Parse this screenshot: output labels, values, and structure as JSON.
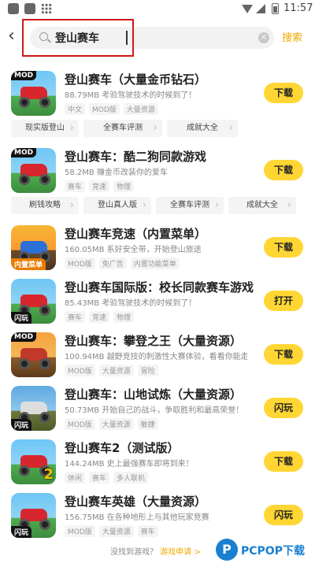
{
  "status_bar": {
    "time": "11:57"
  },
  "header": {
    "search_value": "登山赛车",
    "search_button": "搜索"
  },
  "apps": [
    {
      "title": "登山赛车（大量金币钻石）",
      "desc": "88.79MB 考验驾驶技术的时候到了！",
      "tags": [
        "中文",
        "MOD版",
        "大量资源"
      ],
      "button": "下载",
      "badge_tl": "MOD",
      "badge_bl": "",
      "badge_br": ""
    },
    {
      "title": "登山赛车：酷二狗同款游戏",
      "desc": "58.2MB 赚金币改装你的爱车",
      "tags": [
        "赛车",
        "竞速",
        "物理"
      ],
      "button": "下载",
      "badge_tl": "MOD",
      "badge_bl": "",
      "badge_br": ""
    },
    {
      "title": "登山赛车竞速（内置菜单）",
      "desc": "160.05MB 系好安全带，开始登山旅途",
      "tags": [
        "MOD版",
        "免广告",
        "内置功能菜单"
      ],
      "button": "下载",
      "badge_tl": "",
      "badge_bl": "内置菜单",
      "badge_br": ""
    },
    {
      "title": "登山赛车国际版：校长同款赛车游戏",
      "desc": "85.43MB 考验驾驶技术的时候到了！",
      "tags": [
        "赛车",
        "竞速",
        "物理"
      ],
      "button": "打开",
      "badge_tl": "",
      "badge_bl": "闪玩",
      "badge_br": ""
    },
    {
      "title": "登山赛车：攀登之王（大量资源）",
      "desc": "100.94MB 越野竞技的刺激性大赛体验，看看你能走多远",
      "tags": [
        "MOD版",
        "大量资源",
        "冒险"
      ],
      "button": "下载",
      "badge_tl": "MOD",
      "badge_bl": "",
      "badge_br": ""
    },
    {
      "title": "登山赛车：山地试炼（大量资源）",
      "desc": "50.73MB 开始自己的战斗，争取胜利和最高荣誉！",
      "tags": [
        "MOD版",
        "大量资源",
        "敏捷"
      ],
      "button": "闪玩",
      "badge_tl": "",
      "badge_bl": "闪玩",
      "badge_br": ""
    },
    {
      "title": "登山赛车2（测试版）",
      "desc": "144.24MB 史上最强赛车即将到来！",
      "tags": [
        "休闲",
        "赛车",
        "多人联机"
      ],
      "button": "下载",
      "badge_tl": "",
      "badge_bl": "",
      "badge_br": "2"
    },
    {
      "title": "登山赛车英雄（大量资源）",
      "desc": "156.75MB 在各种地形上与其他玩家竞赛",
      "tags": [
        "MOD版",
        "大量资源",
        "赛车"
      ],
      "button": "闪玩",
      "badge_tl": "",
      "badge_bl": "闪玩",
      "badge_br": ""
    }
  ],
  "related_1": [
    "现实版登山",
    "全赛车评测",
    "成就大全"
  ],
  "related_2": [
    "刷钱攻略",
    "登山真人版",
    "全赛车评测",
    "成就大全"
  ],
  "footer": {
    "text": "没找到游戏？",
    "link": "游戏申请 >"
  },
  "watermark": {
    "letter": "P",
    "text": "PCPOP下载"
  },
  "colors": {
    "accent": "#ffd633",
    "highlight": "#d01818",
    "search_link": "#f0a800"
  }
}
